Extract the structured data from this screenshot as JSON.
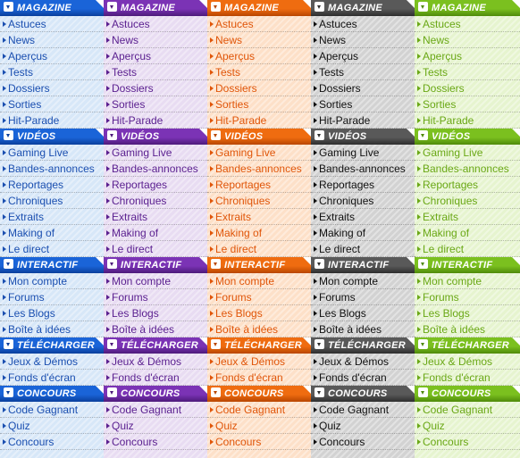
{
  "sections": [
    {
      "title": "MAGAZINE",
      "items": [
        "Astuces",
        "News",
        "Aperçus",
        "Tests",
        "Dossiers",
        "Sorties",
        "Hit-Parade"
      ]
    },
    {
      "title": "VIDÉOS",
      "items": [
        "Gaming Live",
        "Bandes-annonces",
        "Reportages",
        "Chroniques",
        "Extraits",
        "Making of",
        "Le direct"
      ]
    },
    {
      "title": "INTERACTIF",
      "items": [
        "Mon compte",
        "Forums",
        "Les Blogs",
        "Boîte à idées"
      ]
    },
    {
      "title": "TÉLÉCHARGER",
      "items": [
        "Jeux & Démos",
        "Fonds d'écran"
      ]
    },
    {
      "title": "CONCOURS",
      "items": [
        "Code Gagnant",
        "Quiz",
        "Concours"
      ]
    }
  ],
  "themes": [
    {
      "name": "blue",
      "header": "#1a64d8",
      "header_dark": "#0a3f9c",
      "bg": "#d7e7f8",
      "text": "#1b4fb0"
    },
    {
      "name": "purple",
      "header": "#7b33b5",
      "header_dark": "#4d1a7a",
      "bg": "#e8dcf2",
      "text": "#5a1f8f"
    },
    {
      "name": "orange",
      "header": "#ef6c10",
      "header_dark": "#b84600",
      "bg": "#fde0c8",
      "text": "#e0560a"
    },
    {
      "name": "gray",
      "header": "#595959",
      "header_dark": "#2e2e2e",
      "bg": "#d2d2d2",
      "text": "#111111"
    },
    {
      "name": "green",
      "header": "#7bc01f",
      "header_dark": "#4f8a0a",
      "bg": "#e6f4cf",
      "text": "#6aa816"
    }
  ]
}
